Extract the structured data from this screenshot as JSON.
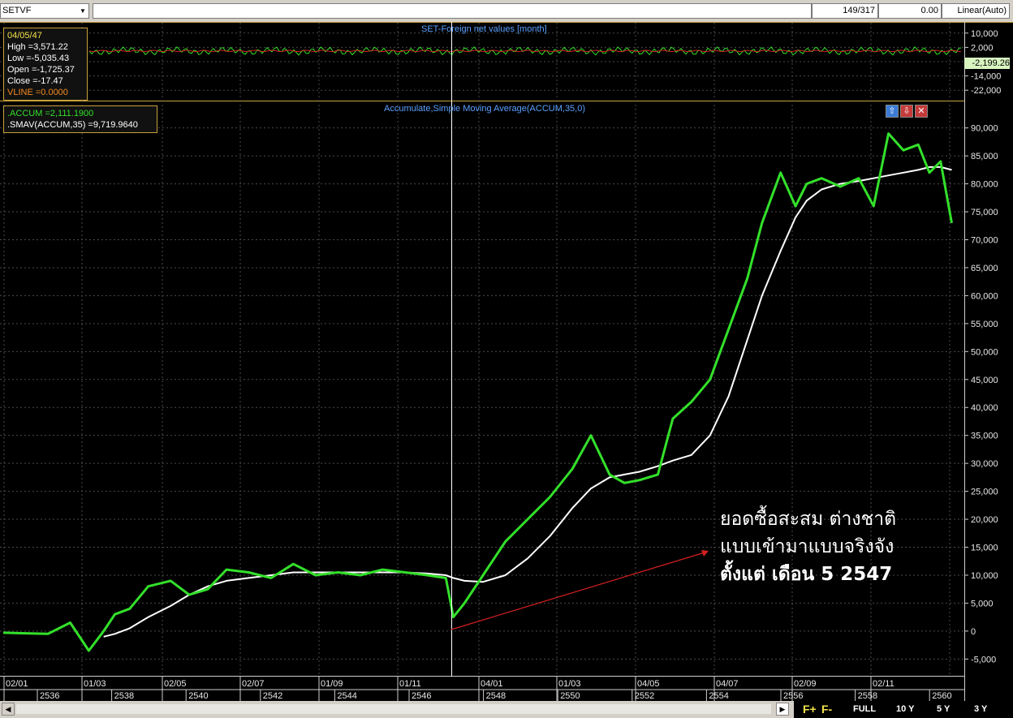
{
  "toolbar": {
    "symbol": "SETVF",
    "record_position": "149/317",
    "value_field": "0.00",
    "scale_mode": "Linear(Auto)"
  },
  "top_panel": {
    "title": "SET-Foreign net values [month]",
    "info": {
      "date": "04/05/47",
      "high": "High  =3,571.22",
      "low": "Low  =-5,035.43",
      "open": "Open  =-1,725.37",
      "close": "Close  =-17.47",
      "vline": " VLINE  =0.0000"
    },
    "y_ticks": [
      "10,000",
      "2,000",
      "-6,000",
      "-14,000",
      "-22,000"
    ],
    "current_value": "-2,199.26"
  },
  "main_panel": {
    "title": "Accumulate,Simple Moving Average(ACCUM,35,0)",
    "legend": {
      "accum": ".ACCUM   =2,111.1900",
      "smav": ".SMAV(ACCUM,35)   =9,719.9640"
    },
    "buttons": {
      "up": "⇧",
      "down": "⇩",
      "close": "✕"
    },
    "annotation": [
      "ยอดซื้อสะสม ต่างชาติ",
      "แบบเข้ามาแบบจริงจัง",
      "ตั้งแต่ เดือน 5 2547"
    ]
  },
  "x_axis": {
    "month_labels": [
      "02/01",
      "01/03",
      "02/05",
      "02/07",
      "01/09",
      "01/11",
      "04/01",
      "01/03",
      "04/05",
      "04/07",
      "02/09",
      "02/11"
    ],
    "year_labels": [
      "2536",
      "2538",
      "2540",
      "2542",
      "2544",
      "2546",
      "2548",
      "2550",
      "2552",
      "2554",
      "2556",
      "2558",
      "2560"
    ]
  },
  "period_buttons": [
    "F+",
    "F-",
    "FULL",
    "10 Y",
    "5 Y",
    "3 Y"
  ],
  "colors": {
    "accum": "#33e12a",
    "smav": "#ffffff",
    "vline": "#ffffff",
    "arrow": "#d42020",
    "title": "#5aa0ff",
    "box_border": "#c8a23c"
  },
  "chart_data": [
    {
      "type": "line",
      "title": "SET-Foreign net values [month]",
      "ylim": [
        -26000,
        14000
      ],
      "series": [
        {
          "name": "SET-Foreign net values",
          "values": [
            -2199.26
          ]
        }
      ]
    },
    {
      "type": "line",
      "title": "Accumulate,Simple Moving Average(ACCUM,35,0)",
      "ylim": [
        -8000,
        93000
      ],
      "x": [
        2535.0,
        2535.6,
        2536.2,
        2536.8,
        2537.3,
        2537.7,
        2538.0,
        2538.4,
        2538.9,
        2539.5,
        2540.0,
        2540.5,
        2541.0,
        2541.6,
        2542.2,
        2542.8,
        2543.4,
        2544.0,
        2544.6,
        2545.2,
        2545.8,
        2546.4,
        2546.9,
        2547.1,
        2547.4,
        2547.9,
        2548.5,
        2549.1,
        2549.7,
        2550.3,
        2550.8,
        2551.3,
        2551.7,
        2552.1,
        2552.6,
        2553.0,
        2553.5,
        2554.0,
        2554.5,
        2555.0,
        2555.4,
        2555.9,
        2556.3,
        2556.6,
        2557.0,
        2557.5,
        2558.0,
        2558.4,
        2558.8,
        2559.2,
        2559.6,
        2559.9,
        2560.2,
        2560.5
      ],
      "series": [
        {
          "name": ".ACCUM",
          "values": [
            -300,
            -400,
            -500,
            1500,
            -3500,
            0,
            3000,
            4000,
            8000,
            9000,
            6500,
            7500,
            11000,
            10500,
            9500,
            12000,
            10000,
            10500,
            10000,
            11000,
            10500,
            10000,
            9500,
            2500,
            5000,
            10000,
            16000,
            20000,
            24000,
            29000,
            35000,
            28000,
            26500,
            27000,
            28000,
            38000,
            41000,
            45000,
            54000,
            63000,
            73000,
            82000,
            76000,
            80000,
            81000,
            79500,
            81000,
            76000,
            89000,
            86000,
            87000,
            82000,
            84000,
            73000
          ]
        },
        {
          "name": ".SMAV(ACCUM,35)",
          "values": [
            null,
            null,
            null,
            null,
            null,
            -1000,
            -500,
            500,
            2500,
            4500,
            6500,
            8000,
            9000,
            9500,
            10000,
            10500,
            10500,
            10500,
            10500,
            10500,
            10500,
            10300,
            10000,
            9500,
            9000,
            8800,
            10000,
            13000,
            17000,
            22000,
            25500,
            27500,
            28000,
            28500,
            29500,
            30500,
            31500,
            35000,
            42000,
            52000,
            60000,
            68000,
            74000,
            77000,
            79000,
            80000,
            80500,
            81000,
            81500,
            82000,
            82500,
            83000,
            83000,
            82500
          ]
        }
      ]
    }
  ]
}
